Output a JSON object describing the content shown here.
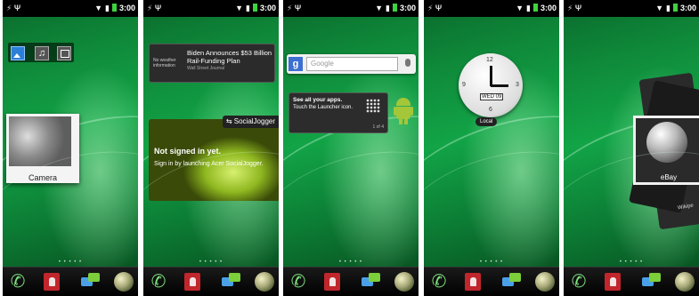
{
  "status_bar": {
    "time": "3:00",
    "icons": [
      "usb-icon",
      "wifi-icon",
      "notification-icon",
      "signal-icon",
      "battery-icon"
    ]
  },
  "dock": {
    "items": [
      "phone-icon",
      "contacts-icon",
      "messaging-icon",
      "browser-icon"
    ]
  },
  "screens": [
    {
      "media_bar": [
        "photo-icon",
        "music-icon",
        "video-icon"
      ],
      "camera_label": "Camera"
    },
    {
      "news": {
        "weather": "No weather information",
        "headline": "Biden Announces $53 Billion Rail-Funding Plan",
        "source": "Wall Street Journal"
      },
      "social": {
        "header": "SocialJogger",
        "title": "Not signed in yet.",
        "subtitle": "Sign in by launching Acer SocialJogger."
      }
    },
    {
      "search": {
        "placeholder": "Google"
      },
      "tip": {
        "line1": "See all your apps.",
        "line2": "Touch the Launcher icon.",
        "page": "1 of 4"
      }
    },
    {
      "clock": {
        "date": "WED 09",
        "n12": "12",
        "n3": "3",
        "n6": "6",
        "n9": "9",
        "label": "Local"
      }
    },
    {
      "ebay_label": "eBay",
      "wiki_label": "Wikipe"
    }
  ],
  "colors": {
    "accent_green": "#12a447",
    "dock_bg": "#000000"
  }
}
